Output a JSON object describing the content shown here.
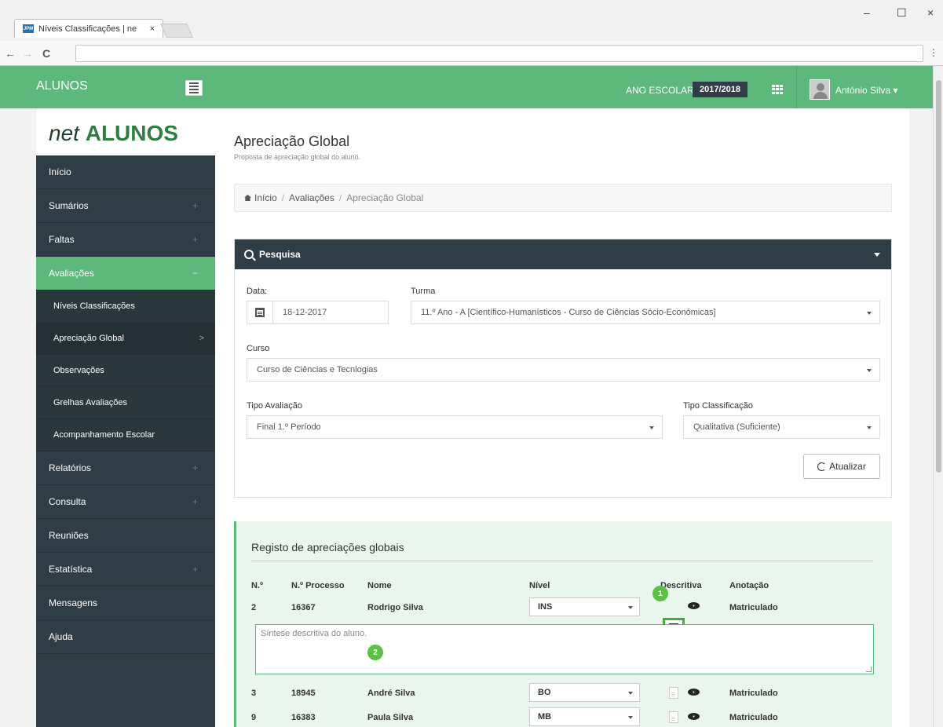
{
  "browser": {
    "tab_title": "Níveis Classificações | ne",
    "tab_close": "×",
    "favicon_text": "JPM",
    "minimize": "–",
    "maximize": "☐",
    "close": "×",
    "back": "←",
    "forward": "→",
    "reload": "C",
    "menu": "⋮"
  },
  "appbar": {
    "title": "ALUNOS",
    "year_label": "ANO ESCOLAR",
    "year_value": "2017/2018",
    "user_name": "António Silva ▾"
  },
  "logo": {
    "net": "net",
    "alunos": "ALUNOS"
  },
  "sidebar": {
    "items": [
      {
        "label": "Início",
        "plus": ""
      },
      {
        "label": "Sumários",
        "plus": "+"
      },
      {
        "label": "Faltas",
        "plus": "+"
      },
      {
        "label": "Avaliações",
        "plus": "−"
      },
      {
        "label": "Relatórios",
        "plus": "+"
      },
      {
        "label": "Consulta",
        "plus": "+"
      },
      {
        "label": "Reuniões",
        "plus": ""
      },
      {
        "label": "Estatística",
        "plus": "+"
      },
      {
        "label": "Mensagens",
        "plus": ""
      },
      {
        "label": "Ajuda",
        "plus": ""
      }
    ],
    "sub_items": [
      {
        "label": "Níveis Classificações"
      },
      {
        "label": "Apreciação Global",
        "chevron": ">"
      },
      {
        "label": "Observações"
      },
      {
        "label": "Grelhas Avaliações"
      },
      {
        "label": "Acompanhamento Escolar"
      }
    ]
  },
  "page": {
    "title": "Apreciação Global",
    "subtitle": "Proposta de apreciação global do aluno."
  },
  "breadcrumb": {
    "home": "Início",
    "section": "Avaliações",
    "current": "Apreciação Global",
    "sep": "/"
  },
  "search": {
    "title": "Pesquisa",
    "date_label": "Data:",
    "date_value": "18-12-2017",
    "turma_label": "Turma",
    "turma_value": "11.º Ano - A [Científico-Humanísticos - Curso de Ciências Sócio-Económicas]",
    "curso_label": "Curso",
    "curso_value": "Curso de Ciências e Tecnlogias",
    "tipo_aval_label": "Tipo Avaliação",
    "tipo_aval_value": "Final 1.º Período",
    "tipo_class_label": "Tipo Classificação",
    "tipo_class_value": "Qualitativa (Suficiente)",
    "update_label": "Atualizar"
  },
  "registo": {
    "title": "Registo de apreciações globais",
    "headers": {
      "num": "N.º",
      "processo": "N.º Processo",
      "nome": "Nome",
      "nivel": "Nível",
      "descritiva": "Descritiva",
      "anotacao": "Anotação"
    },
    "rows": [
      {
        "num": "2",
        "processo": "16367",
        "nome": "Rodrigo Silva",
        "nivel": "INS",
        "anotacao": "Matriculado"
      },
      {
        "num": "3",
        "processo": "18945",
        "nome": "André Silva",
        "nivel": "BO",
        "anotacao": "Matriculado"
      },
      {
        "num": "9",
        "processo": "16383",
        "nome": "Paula Silva",
        "nivel": "MB",
        "anotacao": "Matriculado"
      }
    ],
    "desc_placeholder": "Síntese descritiva do aluno.",
    "badge1": "1",
    "badge2": "2"
  },
  "colors": {
    "green": "#5cb87b",
    "dark": "#2f3e46",
    "badge": "#5cc046"
  }
}
